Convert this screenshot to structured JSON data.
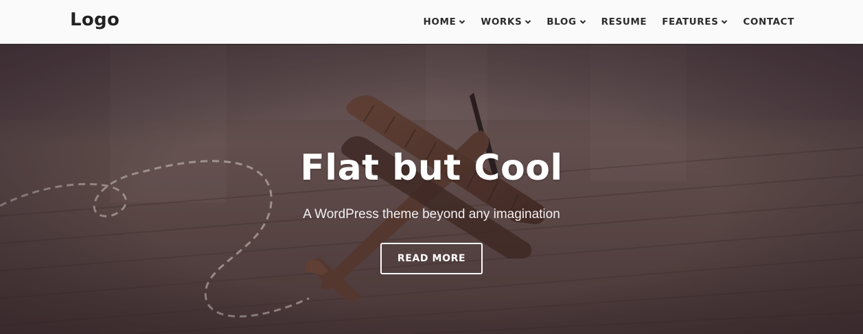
{
  "header": {
    "logo": "Logo",
    "nav": [
      {
        "label": "HOME",
        "dropdown": true
      },
      {
        "label": "WORKS",
        "dropdown": true
      },
      {
        "label": "BLOG",
        "dropdown": true
      },
      {
        "label": "RESUME",
        "dropdown": false
      },
      {
        "label": "FEATURES",
        "dropdown": true
      },
      {
        "label": "CONTACT",
        "dropdown": false
      }
    ]
  },
  "hero": {
    "title": "Flat but Cool",
    "subtitle": "A WordPress theme beyond any imagination",
    "button_label": "READ MORE",
    "background_image": "toy-wooden-airplane-on-wood-floor",
    "overlay_color": "#48344280"
  },
  "colors": {
    "header_bg": "#fbfafb",
    "nav_text": "#2b2b2b",
    "hero_text": "#ffffff"
  }
}
